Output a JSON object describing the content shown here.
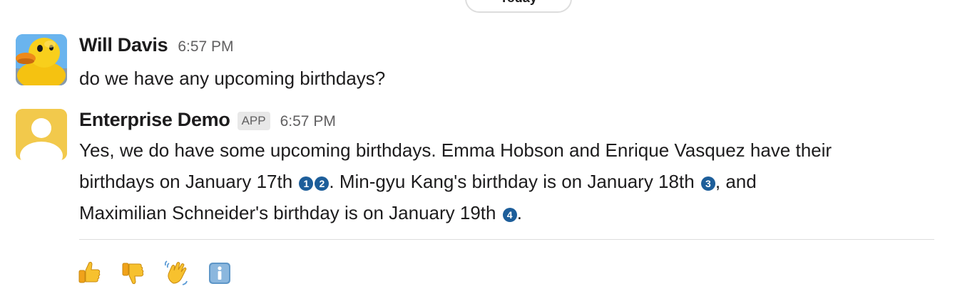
{
  "date_divider": {
    "label": "Today"
  },
  "messages": [
    {
      "sender": "Will Davis",
      "timestamp": "6:57 PM",
      "text": "do we have any upcoming birthdays?"
    },
    {
      "sender": "Enterprise Demo",
      "badge": "APP",
      "timestamp": "6:57 PM",
      "segments": {
        "line1": "Yes, we do have some upcoming birthdays. Emma Hobson and Enrique Vasquez have their",
        "part2": "birthdays on January 17th ",
        "cite1": "1",
        "cite2": "2",
        "part3": ". Min-gyu Kang's birthday is on January 18th ",
        "cite3": "3",
        "part4": ", and",
        "part5": "Maximilian Schneider's birthday is on January 19th ",
        "cite4": "4",
        "part6": "."
      }
    }
  ],
  "feedback_actions": [
    {
      "icon": "thumbs-up-icon"
    },
    {
      "icon": "thumbs-down-icon"
    },
    {
      "icon": "waving-hand-icon"
    },
    {
      "icon": "info-icon"
    }
  ],
  "colors": {
    "citation": "#1d5e9a",
    "default_avatar": "#f2c94c",
    "divider": "#dddddd",
    "timestamp": "#616061"
  }
}
